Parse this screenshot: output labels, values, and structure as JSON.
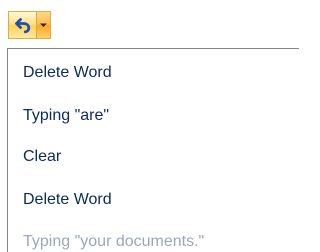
{
  "toolbar": {
    "undo_icon": "undo-arrow-icon",
    "dropdown_icon": "chevron-down-icon",
    "colors": {
      "undo_arrow": "#1f4fb4",
      "dropdown_arrow": "#2a2a2a",
      "accent_border": "#e0ad3c"
    }
  },
  "history": {
    "items": [
      {
        "label": "Delete Word"
      },
      {
        "label": "Typing \"are\""
      },
      {
        "label": "Clear"
      },
      {
        "label": "Delete Word"
      },
      {
        "label": "Typing \"your documents.\""
      }
    ]
  }
}
